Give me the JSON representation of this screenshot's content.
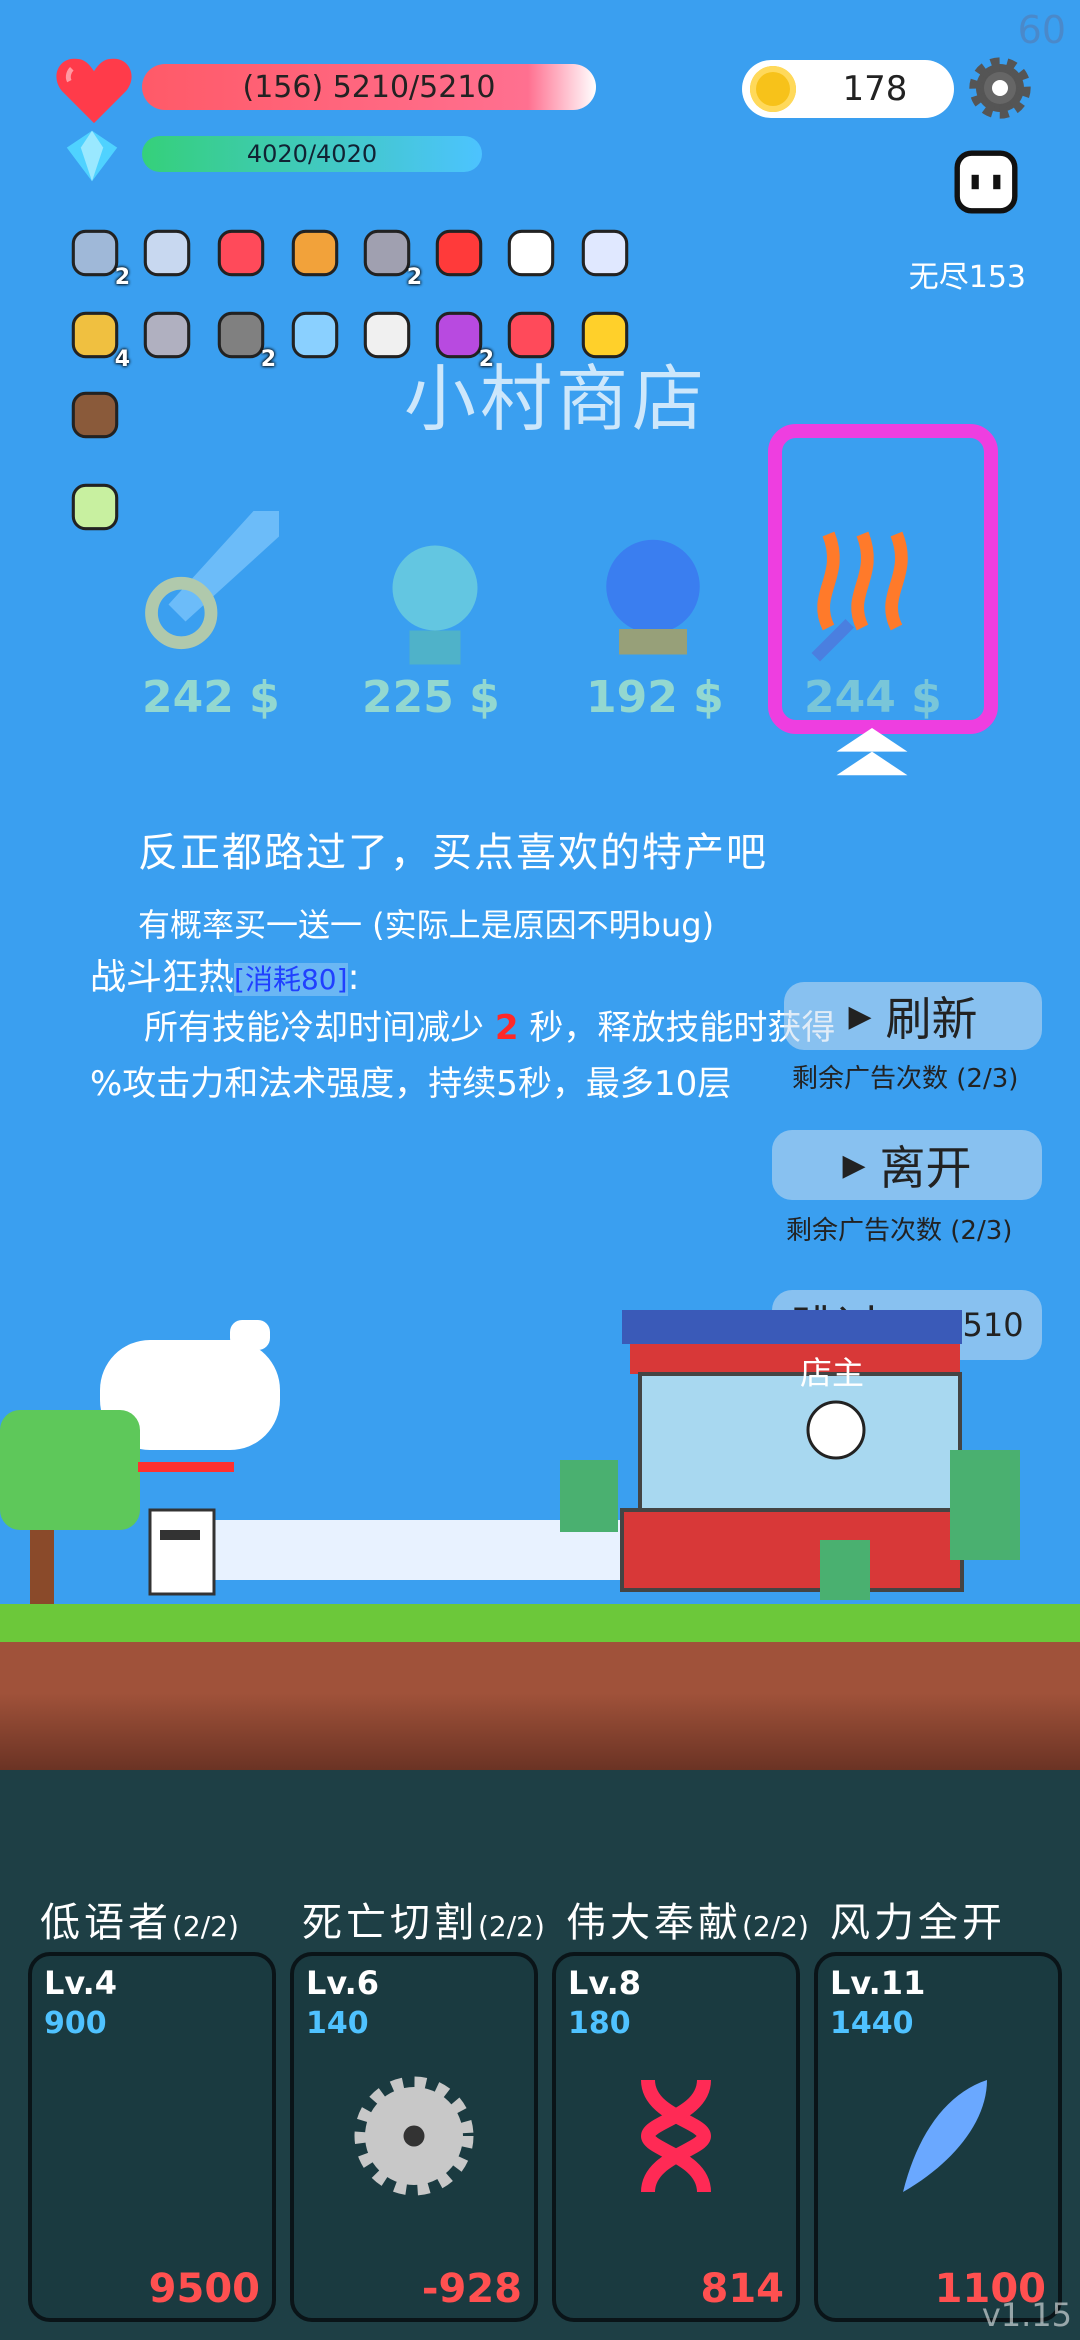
{
  "hud": {
    "fps": "60",
    "hp_text": "(156) 5210/5210",
    "mp_text": "4020/4020",
    "coins": "178",
    "mode_label": "无尽153",
    "version": "v1.15"
  },
  "items": [
    {
      "icon": "sword-icon",
      "count": "2"
    },
    {
      "icon": "short-sword-icon",
      "count": ""
    },
    {
      "icon": "strawberry-icon",
      "count": ""
    },
    {
      "icon": "book-icon",
      "count": ""
    },
    {
      "icon": "axe-icon",
      "count": "2"
    },
    {
      "icon": "apple-icon",
      "count": ""
    },
    {
      "icon": "ghost-icon",
      "count": ""
    },
    {
      "icon": "ring-icon",
      "count": ""
    },
    {
      "icon": "bow-icon",
      "count": "4"
    },
    {
      "icon": "horned-helmet-icon",
      "count": ""
    },
    {
      "icon": "meteor-icon",
      "count": "2"
    },
    {
      "icon": "potion-icon",
      "count": ""
    },
    {
      "icon": "dice-icon",
      "count": ""
    },
    {
      "icon": "crystal-ball-icon",
      "count": "2"
    },
    {
      "icon": "shield-icon",
      "count": ""
    },
    {
      "icon": "sunflower-icon",
      "count": ""
    },
    {
      "icon": "coconut-icon",
      "count": ""
    },
    {
      "icon": "lightbulb-icon",
      "count": ""
    }
  ],
  "shop": {
    "title": "小村商店",
    "items": [
      {
        "name": "sword-ring",
        "price": "242 $"
      },
      {
        "name": "spirit",
        "price": "225 $"
      },
      {
        "name": "crystal-orb",
        "price": "192 $"
      },
      {
        "name": "heat-blade",
        "price": "244 $"
      }
    ],
    "selected_index": 3
  },
  "description": {
    "headline": "反正都路过了，买点喜欢的特产吧",
    "subline": "有概率买一送一 (实际上是原因不明bug)",
    "skill_name": "战斗狂热",
    "skill_cost": "消耗80",
    "effect_pre": "所有技能冷却时间减少",
    "effect_num": "2",
    "effect_post": "秒，释放技能时获得",
    "effect_line2": "%攻击力和法术强度，持续5秒，最多10层"
  },
  "buttons": {
    "refresh": "刷新",
    "refresh_ads": "剩余广告次数 (2/3)",
    "leave": "离开",
    "leave_ads": "剩余广告次数 (2/3)",
    "skip": "跳过",
    "skip_hp": "HP+510",
    "shopkeeper": "店主"
  },
  "skills": [
    {
      "name": "低语者",
      "uses": "(2/2)",
      "level": "Lv.4",
      "cost": "900",
      "value": "9500",
      "icon": "crescent-moon-icon",
      "color": "#ff2a3c"
    },
    {
      "name": "死亡切割",
      "uses": "(2/2)",
      "level": "Lv.6",
      "cost": "140",
      "value": "-928",
      "icon": "saw-blade-icon",
      "color": "#c8c8c8"
    },
    {
      "name": "伟大奉献",
      "uses": "(2/2)",
      "level": "Lv.8",
      "cost": "180",
      "value": "814",
      "icon": "dna-icon",
      "color": "#ff2a55"
    },
    {
      "name": "风力全开",
      "uses": "",
      "level": "Lv.11",
      "cost": "1440",
      "value": "1100",
      "icon": "feather-icon",
      "color": "#6aa8ff"
    }
  ]
}
